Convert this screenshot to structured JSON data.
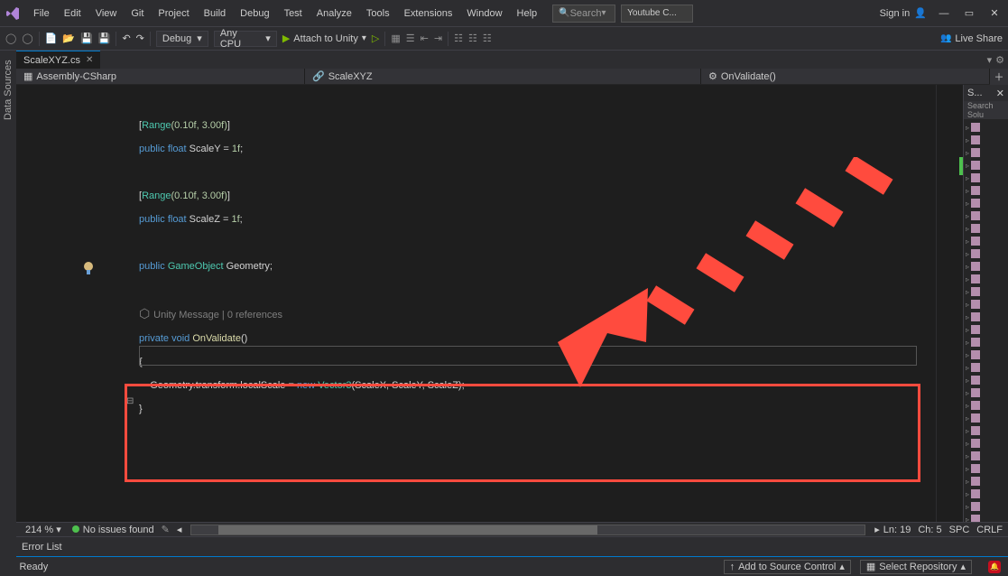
{
  "menu": [
    "File",
    "Edit",
    "View",
    "Git",
    "Project",
    "Build",
    "Debug",
    "Test",
    "Analyze",
    "Tools",
    "Extensions",
    "Window",
    "Help"
  ],
  "search_label": "Search",
  "title": "Youtube C...",
  "signin": "Sign in",
  "config": "Debug",
  "platform": "Any CPU",
  "attach": "Attach to Unity",
  "liveshare": "Live Share",
  "sidetab1": "Data Sources",
  "tab_name": "ScaleXYZ.cs",
  "nav_assembly": "Assembly-CSharp",
  "nav_class": "ScaleXYZ",
  "nav_method": "OnValidate()",
  "solution_search": "Search Solu",
  "solution_header": "S...",
  "zoom": "214 %",
  "no_issues": "No issues found",
  "errorlist": "Error List",
  "ready": "Ready",
  "status_source": "Add to Source Control",
  "status_repo": "Select Repository",
  "ln": "Ln: 19",
  "ch": "Ch: 5",
  "spc": "SPC",
  "crlf": "CRLF",
  "ref_label": "Unity Message | 0 references",
  "code": {
    "l1a": "[",
    "l1b": "Range",
    "l1c": "(0.10f, 3.00f)",
    "l1d": "]",
    "l2a": "public",
    "l2b": "float",
    "l2c": "ScaleY = ",
    "l2d": "1f",
    "l2e": ";",
    "l3a": "[",
    "l3b": "Range",
    "l3c": "(0.10f, 3.00f)",
    "l3d": "]",
    "l4a": "public",
    "l4b": "float",
    "l4c": "ScaleZ = ",
    "l4d": "1f",
    "l4e": ";",
    "l5a": "public",
    "l5b": "GameObject",
    "l5c": "Geometry;",
    "l6a": "private",
    "l6b": "void",
    "l6c": "OnValidate",
    "l6d": "()",
    "l7": "{",
    "l8a": "    Geometry.transform.localScale = ",
    "l8b": "new",
    "l8c": "Vector3",
    "l8d": "(ScaleX, ScaleY, ScaleZ);",
    "l9": "}"
  }
}
